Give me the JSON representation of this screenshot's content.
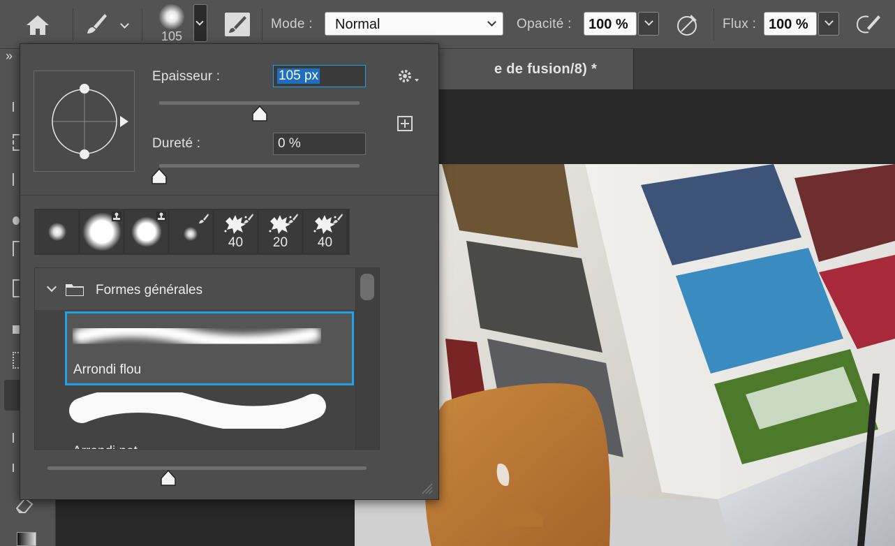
{
  "options_bar": {
    "brush_size_label": "105",
    "mode_label": "Mode :",
    "mode_value": "Normal",
    "opacity_label": "Opacité :",
    "opacity_value": "100 %",
    "flow_label": "Flux :",
    "flow_value": "100 %"
  },
  "document_tab": {
    "title": "e de fusion/8) *"
  },
  "toolbar": {
    "collapse_label": "»"
  },
  "brush_panel": {
    "size_label": "Epaisseur :",
    "size_value": "105 px",
    "size_fraction": 0.5,
    "hardness_label": "Dureté :",
    "hardness_value": "0 %",
    "hardness_fraction": 0.0,
    "recent_presets": [
      {
        "type": "soft-round",
        "label": ""
      },
      {
        "type": "soft-round-stamp",
        "label": ""
      },
      {
        "type": "soft-round-stamp",
        "label": ""
      },
      {
        "type": "soft-round-brush",
        "label": ""
      },
      {
        "type": "splatter-brush",
        "label": "40"
      },
      {
        "type": "splatter-brush",
        "label": "20"
      },
      {
        "type": "splatter-brush",
        "label": "40"
      }
    ],
    "group_name": "Formes générales",
    "brushes": [
      {
        "name": "Arrondi flou",
        "selected": true
      },
      {
        "name": "Arrondi net",
        "selected": false
      }
    ],
    "preview_size_fraction": 0.5
  },
  "colors": {
    "accent": "#1fa3e8",
    "panel_bg": "#4d4d4d",
    "app_bg": "#535353"
  }
}
